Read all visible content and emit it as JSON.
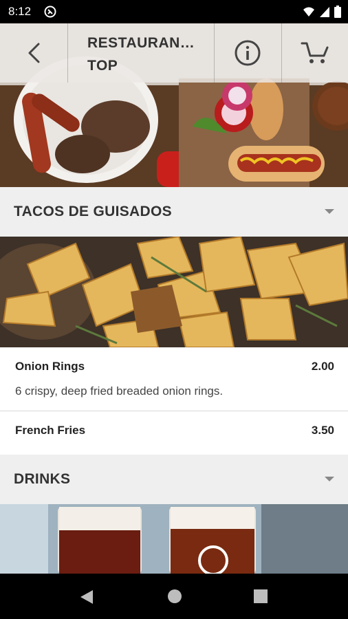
{
  "status_bar": {
    "time": "8:12"
  },
  "header": {
    "title_line1": "RESTAURAN…",
    "title_line2": "TOP",
    "icons": {
      "back": "back-arrow-icon",
      "info": "info-icon",
      "cart": "cart-icon"
    }
  },
  "sections": [
    {
      "title": "TACOS DE GUISADOS",
      "items": [
        {
          "name": "Onion Rings",
          "price": "2.00",
          "description": "6 crispy, deep fried breaded onion rings."
        },
        {
          "name": "French Fries",
          "price": "3.50"
        }
      ]
    },
    {
      "title": "DRINKS"
    }
  ],
  "colors": {
    "section_bg": "#efefef",
    "text": "#333333",
    "bar": "#000000"
  }
}
